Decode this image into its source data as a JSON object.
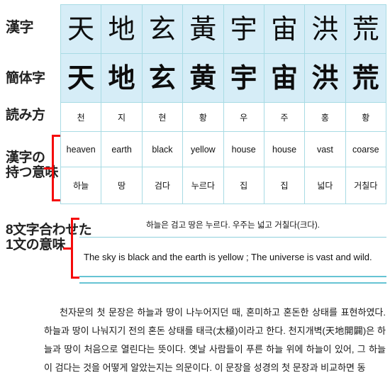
{
  "labels": {
    "traditional": "漢字",
    "simplified": "簡体字",
    "reading": "読み方",
    "meaning_line1": "漢字の",
    "meaning_line2": "持つ意味",
    "sentence_line1": "8文字合わせた",
    "sentence_line2": "1文の意味"
  },
  "colors": {
    "cell_background": "#d6edf7",
    "grid_line": "#a8dbe4",
    "bracket_red": "#f50a0a",
    "rule_teal": "#66c4d4"
  },
  "table": {
    "traditional": [
      "天",
      "地",
      "玄",
      "黃",
      "宇",
      "宙",
      "洪",
      "荒"
    ],
    "simplified": [
      "天",
      "地",
      "玄",
      "黄",
      "宇",
      "宙",
      "洪",
      "荒"
    ],
    "reading": [
      "천",
      "지",
      "현",
      "황",
      "우",
      "주",
      "홍",
      "황"
    ],
    "meaning_en": [
      "heaven",
      "earth",
      "black",
      "yellow",
      "house",
      "house",
      "vast",
      "coarse"
    ],
    "meaning_ko": [
      "하늘",
      "땅",
      "검다",
      "누르다",
      "집",
      "집",
      "넓다",
      "거칠다"
    ]
  },
  "sentence": {
    "korean": "하늘은 검고 땅은 누르다. 우주는 넓고 거칠다(크다).",
    "english": "The sky is black and the earth is yellow ; The universe is vast and wild."
  },
  "body": {
    "paragraph": "천자문의 첫 문장은 하늘과 땅이 나누어지던 때, 혼미하고 혼돈한 상태를 표현하였다. 하늘과 땅이 나눠지기 전의 혼돈 상태를 태극(太極)이라고 한다. 천지개벽(天地開闢)은 하늘과 땅이 처음으로 열린다는 뜻이다. 옛날 사람들이 푸른 하늘 위에 하늘이 있어, 그 하늘이 검다는 것을 어떻게 알았는지는 의문이다. 이 문장을 성경의 첫 문장과 비교하면 동"
  }
}
